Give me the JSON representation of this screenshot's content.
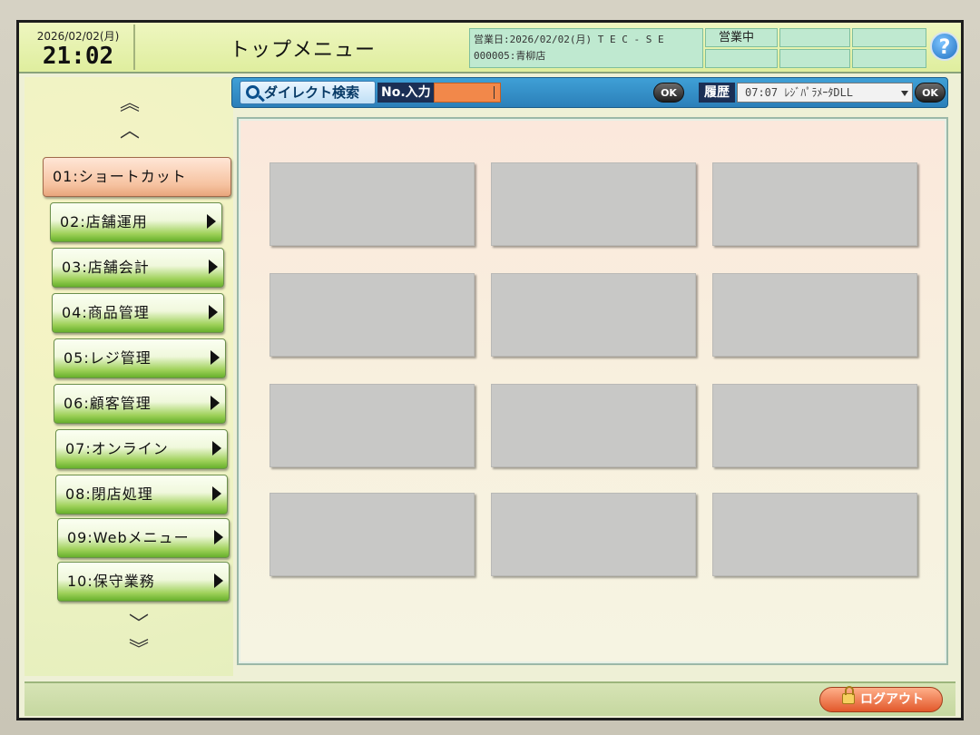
{
  "header": {
    "date": "2026/02/02(月)",
    "time": "21:02",
    "title": "トップメニュー",
    "business_line1": "営業日:2026/02/02(月) T E C - S E",
    "business_line2": "000005:青柳店",
    "status": "営業中",
    "help_label": "?"
  },
  "search": {
    "direct_label": "ダイレクト検索",
    "no_label": "No.入力",
    "no_value": "",
    "ok_label": "OK",
    "history_label": "履歴",
    "history_value": "07:07 ﾚｼﾞﾊﾟﾗﾒｰﾀDLL",
    "history_ok_label": "OK"
  },
  "sidebar": {
    "items": [
      {
        "label": "01:ショートカット",
        "active": true
      },
      {
        "label": "02:店舗運用"
      },
      {
        "label": "03:店舗会計"
      },
      {
        "label": "04:商品管理"
      },
      {
        "label": "05:レジ管理"
      },
      {
        "label": "06:顧客管理"
      },
      {
        "label": "07:オンライン"
      },
      {
        "label": "08:閉店処理"
      },
      {
        "label": "09:Webメニュー"
      },
      {
        "label": "10:保守業務"
      }
    ]
  },
  "footer": {
    "logout_label": "ログアウト"
  }
}
